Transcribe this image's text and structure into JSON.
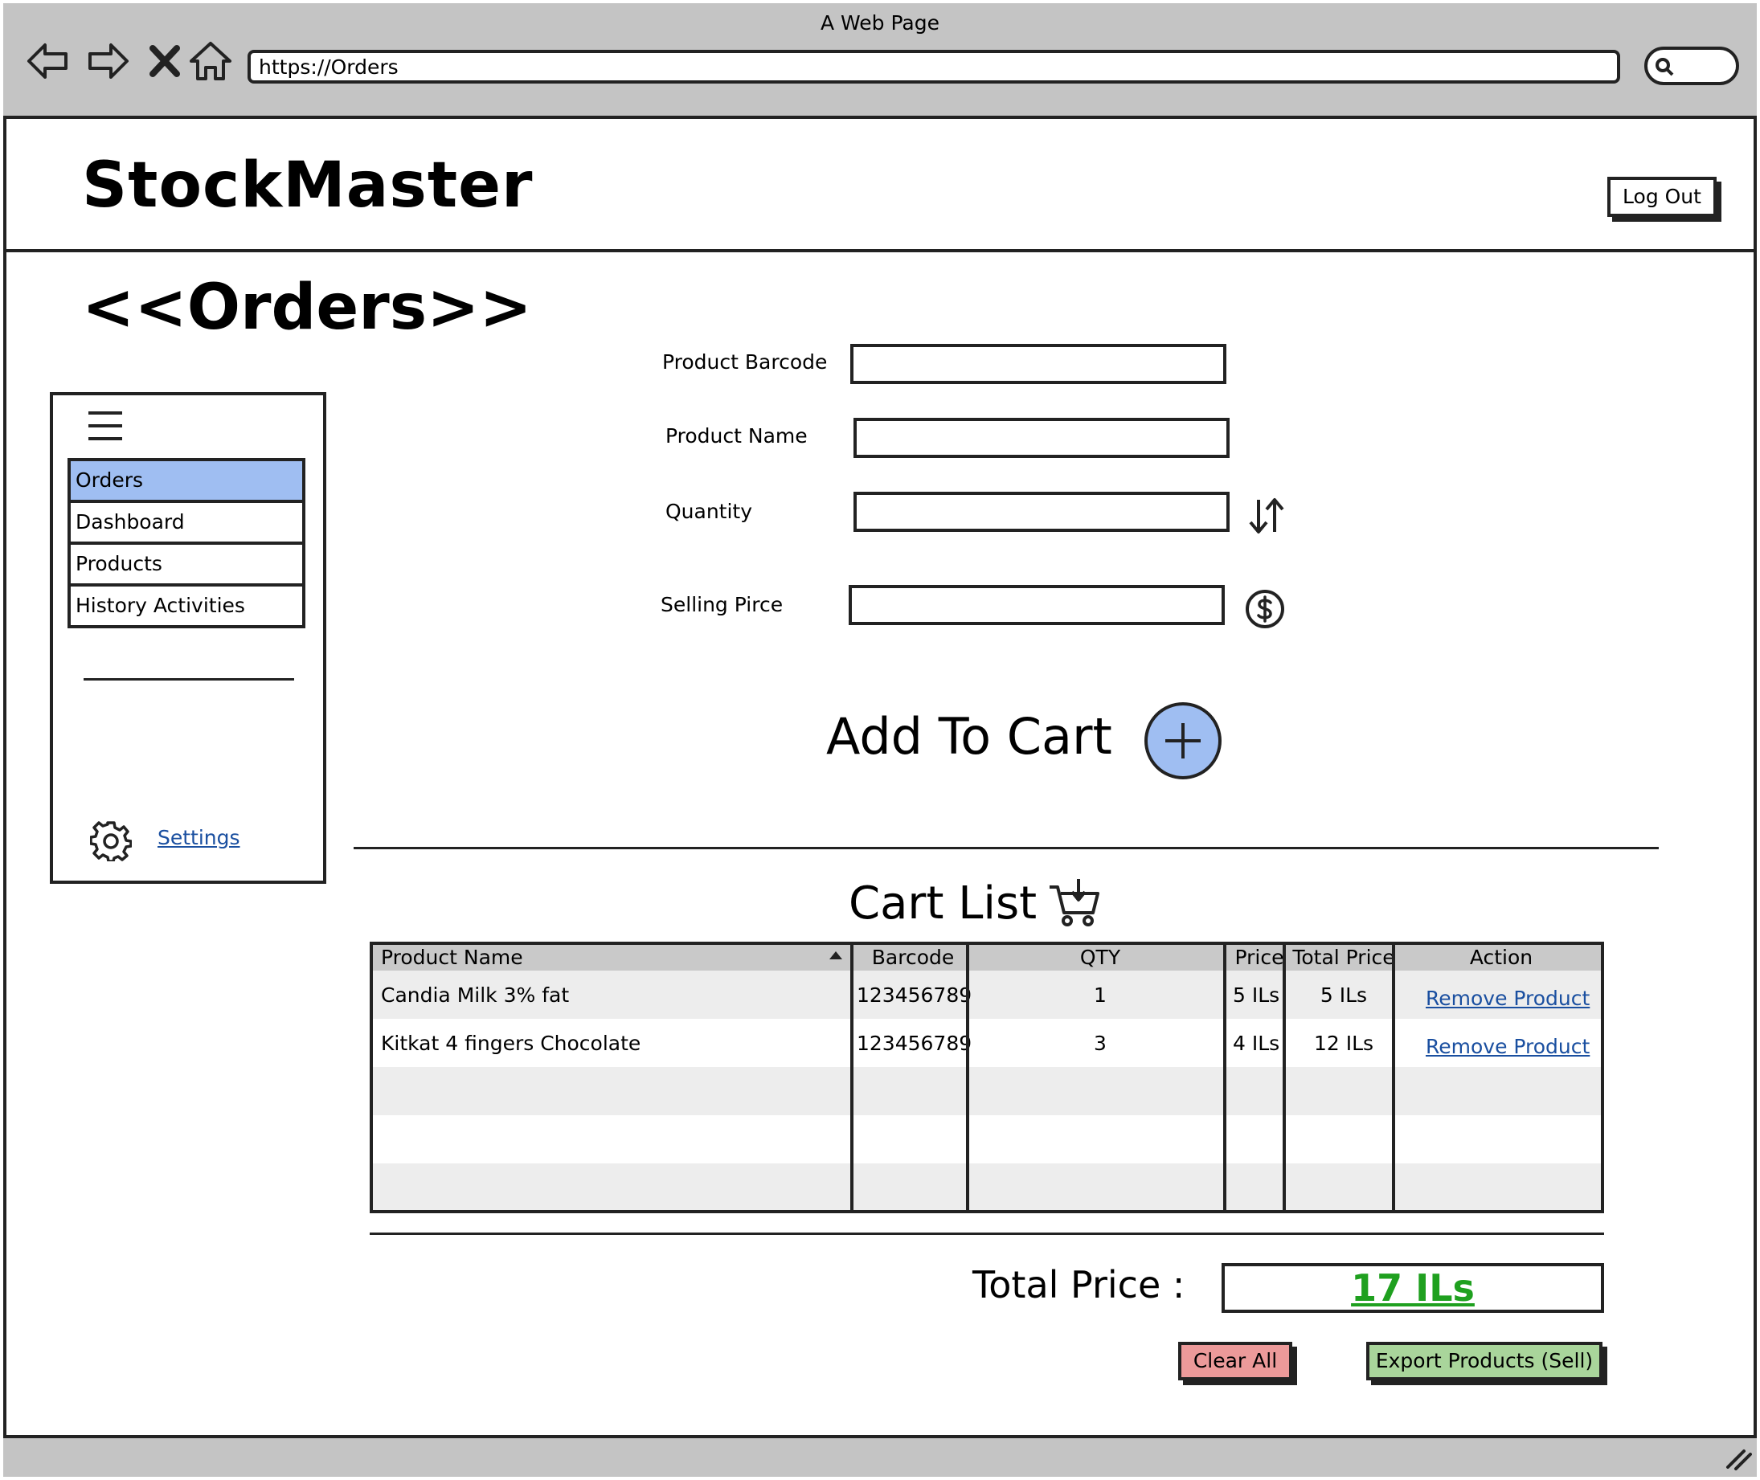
{
  "browser": {
    "window_title": "A Web Page",
    "url": "https://Orders"
  },
  "header": {
    "app_title": "StockMaster",
    "logout_label": "Log Out"
  },
  "page": {
    "heading": "<<Orders>>"
  },
  "sidebar": {
    "items": [
      {
        "label": "Orders",
        "active": true
      },
      {
        "label": "Dashboard",
        "active": false
      },
      {
        "label": "Products",
        "active": false
      },
      {
        "label": "History Activities",
        "active": false
      }
    ],
    "settings_label": "Settings"
  },
  "form": {
    "barcode_label": "Product Barcode",
    "barcode_value": "",
    "name_label": "Product Name",
    "name_value": "",
    "quantity_label": "Quantity",
    "quantity_value": "",
    "price_label": "Selling Pirce",
    "price_value": "",
    "add_to_cart_label": "Add To Cart"
  },
  "cart": {
    "title": "Cart List",
    "columns": [
      "Product Name",
      "Barcode",
      "QTY",
      "Price",
      "Total Price",
      "Action"
    ],
    "rows": [
      {
        "name": "Candia Milk 3% fat",
        "barcode": "123456789",
        "qty": "1",
        "price": "5 ILs",
        "total": "5 ILs",
        "action": "Remove Product"
      },
      {
        "name": "Kitkat 4 fingers Chocolate",
        "barcode": "123456789",
        "qty": "3",
        "price": "4 ILs",
        "total": "12 ILs",
        "action": "Remove Product"
      }
    ],
    "total_label": "Total Price :",
    "total_value": "17 ILs",
    "clear_all_label": "Clear All",
    "export_label": "Export Products (Sell)"
  },
  "colors": {
    "chrome_gray": "#c4c4c4",
    "active_blue": "#9fbef2",
    "link_blue": "#1a4fa0",
    "total_green": "#1fa01f",
    "clear_red": "#ec9a9a",
    "export_green": "#a9d59b"
  },
  "icons": [
    "back-icon",
    "forward-icon",
    "stop-icon",
    "home-icon",
    "search-icon",
    "menu-icon",
    "gear-icon",
    "sort-icon",
    "dollar-icon",
    "plus-icon",
    "cart-icon",
    "sort-ascending-icon",
    "resize-grip-icon"
  ]
}
